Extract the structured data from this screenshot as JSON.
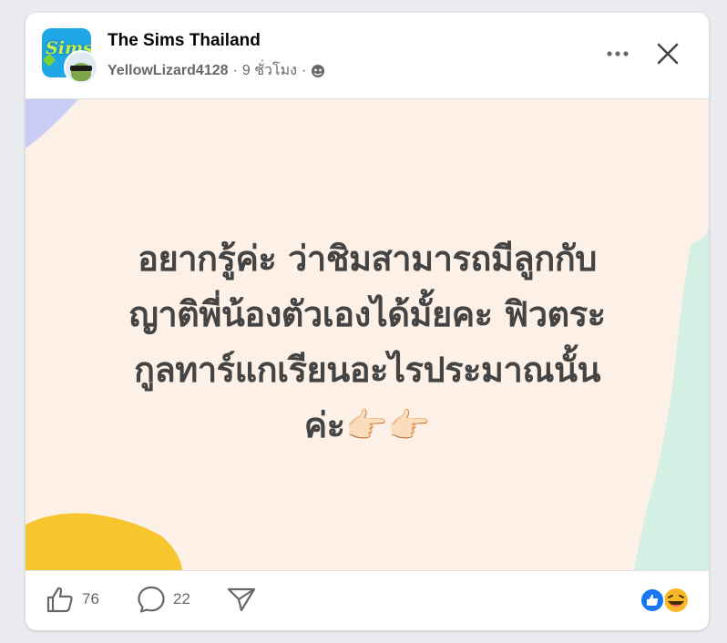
{
  "post": {
    "group_name": "The Sims Thailand",
    "author": "YellowLizard4128",
    "separator": "·",
    "time": "9 ชั่วโมง",
    "text_lines": [
      "อยากรู้ค่ะ ว่าชิมสามารถมีลูกกับ",
      "ญาติพี่น้องตัวเองได้มั้ยคะ ฟิวตระ",
      "กูลทาร์แกเรียนอะไรประมาณนั้น",
      "ค่ะ👉🏻👉🏻"
    ]
  },
  "group_avatar": {
    "logo_text": "Sims"
  },
  "actions": {
    "like_count": "76",
    "comment_count": "22"
  },
  "icons": {
    "privacy": "community-icon",
    "more": "more-options-icon",
    "close": "close-icon",
    "like": "thumbs-up-icon",
    "comment": "comment-icon",
    "share": "share-icon",
    "reaction_like": "like-reaction-icon",
    "reaction_haha": "haha-reaction-icon"
  },
  "colors": {
    "post_background": "#fdf0e6",
    "text": "#444444",
    "accent_blue": "#1877f2",
    "blob_yellow": "#f7c62f",
    "blob_mint": "#d4f0e4",
    "blob_lavender": "#c9cdf5"
  }
}
